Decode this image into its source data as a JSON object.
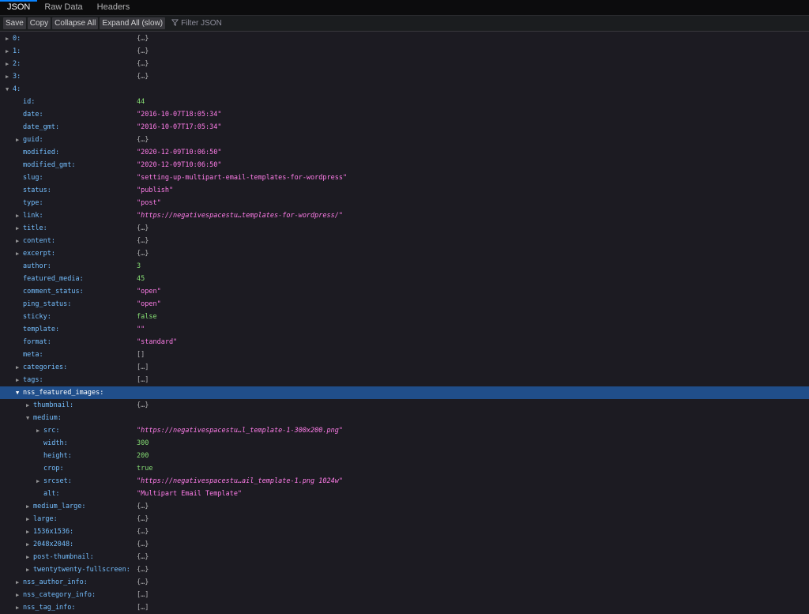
{
  "tabs": [
    {
      "label": "JSON",
      "active": true
    },
    {
      "label": "Raw Data",
      "active": false
    },
    {
      "label": "Headers",
      "active": false
    }
  ],
  "toolbar": {
    "save_label": "Save",
    "copy_label": "Copy",
    "collapse_all_label": "Collapse All",
    "expand_all_label": "Expand All (slow)",
    "filter_placeholder": "Filter JSON"
  },
  "rows": [
    {
      "depth": 0,
      "toggle": "collapsed",
      "key": "0:",
      "value": "{…}",
      "type": "obj"
    },
    {
      "depth": 0,
      "toggle": "collapsed",
      "key": "1:",
      "value": "{…}",
      "type": "obj"
    },
    {
      "depth": 0,
      "toggle": "collapsed",
      "key": "2:",
      "value": "{…}",
      "type": "obj"
    },
    {
      "depth": 0,
      "toggle": "collapsed",
      "key": "3:",
      "value": "{…}",
      "type": "obj"
    },
    {
      "depth": 0,
      "toggle": "expanded",
      "key": "4:",
      "value": "",
      "type": "obj"
    },
    {
      "depth": 1,
      "toggle": "none",
      "key": "id:",
      "value": "44",
      "type": "num"
    },
    {
      "depth": 1,
      "toggle": "none",
      "key": "date:",
      "value": "\"2016-10-07T18:05:34\"",
      "type": "str"
    },
    {
      "depth": 1,
      "toggle": "none",
      "key": "date_gmt:",
      "value": "\"2016-10-07T17:05:34\"",
      "type": "str"
    },
    {
      "depth": 1,
      "toggle": "collapsed",
      "key": "guid:",
      "value": "{…}",
      "type": "obj"
    },
    {
      "depth": 1,
      "toggle": "none",
      "key": "modified:",
      "value": "\"2020-12-09T10:06:50\"",
      "type": "str"
    },
    {
      "depth": 1,
      "toggle": "none",
      "key": "modified_gmt:",
      "value": "\"2020-12-09T10:06:50\"",
      "type": "str"
    },
    {
      "depth": 1,
      "toggle": "none",
      "key": "slug:",
      "value": "\"setting-up-multipart-email-templates-for-wordpress\"",
      "type": "str"
    },
    {
      "depth": 1,
      "toggle": "none",
      "key": "status:",
      "value": "\"publish\"",
      "type": "str"
    },
    {
      "depth": 1,
      "toggle": "none",
      "key": "type:",
      "value": "\"post\"",
      "type": "str"
    },
    {
      "depth": 1,
      "toggle": "collapsed",
      "key": "link:",
      "value": "\"https://negativespacestu…templates-for-wordpress/\"",
      "type": "link"
    },
    {
      "depth": 1,
      "toggle": "collapsed",
      "key": "title:",
      "value": "{…}",
      "type": "obj"
    },
    {
      "depth": 1,
      "toggle": "collapsed",
      "key": "content:",
      "value": "{…}",
      "type": "obj"
    },
    {
      "depth": 1,
      "toggle": "collapsed",
      "key": "excerpt:",
      "value": "{…}",
      "type": "obj"
    },
    {
      "depth": 1,
      "toggle": "none",
      "key": "author:",
      "value": "3",
      "type": "num"
    },
    {
      "depth": 1,
      "toggle": "none",
      "key": "featured_media:",
      "value": "45",
      "type": "num"
    },
    {
      "depth": 1,
      "toggle": "none",
      "key": "comment_status:",
      "value": "\"open\"",
      "type": "str"
    },
    {
      "depth": 1,
      "toggle": "none",
      "key": "ping_status:",
      "value": "\"open\"",
      "type": "str"
    },
    {
      "depth": 1,
      "toggle": "none",
      "key": "sticky:",
      "value": "false",
      "type": "bool"
    },
    {
      "depth": 1,
      "toggle": "none",
      "key": "template:",
      "value": "\"\"",
      "type": "str"
    },
    {
      "depth": 1,
      "toggle": "none",
      "key": "format:",
      "value": "\"standard\"",
      "type": "str"
    },
    {
      "depth": 1,
      "toggle": "none",
      "key": "meta:",
      "value": "[]",
      "type": "obj"
    },
    {
      "depth": 1,
      "toggle": "collapsed",
      "key": "categories:",
      "value": "[…]",
      "type": "obj"
    },
    {
      "depth": 1,
      "toggle": "collapsed",
      "key": "tags:",
      "value": "[…]",
      "type": "obj"
    },
    {
      "depth": 1,
      "toggle": "expanded",
      "key": "nss_featured_images:",
      "value": "",
      "type": "obj",
      "selected": true
    },
    {
      "depth": 2,
      "toggle": "collapsed",
      "key": "thumbnail:",
      "value": "{…}",
      "type": "obj"
    },
    {
      "depth": 2,
      "toggle": "expanded",
      "key": "medium:",
      "value": "",
      "type": "obj"
    },
    {
      "depth": 3,
      "toggle": "collapsed",
      "key": "src:",
      "value": "\"https://negativespacestu…l_template-1-300x200.png\"",
      "type": "link"
    },
    {
      "depth": 3,
      "toggle": "none",
      "key": "width:",
      "value": "300",
      "type": "num"
    },
    {
      "depth": 3,
      "toggle": "none",
      "key": "height:",
      "value": "200",
      "type": "num"
    },
    {
      "depth": 3,
      "toggle": "none",
      "key": "crop:",
      "value": "true",
      "type": "bool"
    },
    {
      "depth": 3,
      "toggle": "collapsed",
      "key": "srcset:",
      "value": "\"https://negativespacestu…ail_template-1.png 1024w\"",
      "type": "link"
    },
    {
      "depth": 3,
      "toggle": "none",
      "key": "alt:",
      "value": "\"Multipart Email Template\"",
      "type": "str"
    },
    {
      "depth": 2,
      "toggle": "collapsed",
      "key": "medium_large:",
      "value": "{…}",
      "type": "obj"
    },
    {
      "depth": 2,
      "toggle": "collapsed",
      "key": "large:",
      "value": "{…}",
      "type": "obj"
    },
    {
      "depth": 2,
      "toggle": "collapsed",
      "key": "1536x1536:",
      "value": "{…}",
      "type": "obj"
    },
    {
      "depth": 2,
      "toggle": "collapsed",
      "key": "2048x2048:",
      "value": "{…}",
      "type": "obj"
    },
    {
      "depth": 2,
      "toggle": "collapsed",
      "key": "post-thumbnail:",
      "value": "{…}",
      "type": "obj"
    },
    {
      "depth": 2,
      "toggle": "collapsed",
      "key": "twentytwenty-fullscreen:",
      "value": "{…}",
      "type": "obj"
    },
    {
      "depth": 1,
      "toggle": "collapsed",
      "key": "nss_author_info:",
      "value": "{…}",
      "type": "obj"
    },
    {
      "depth": 1,
      "toggle": "collapsed",
      "key": "nss_category_info:",
      "value": "[…]",
      "type": "obj"
    },
    {
      "depth": 1,
      "toggle": "collapsed",
      "key": "nss_tag_info:",
      "value": "[…]",
      "type": "obj"
    }
  ]
}
